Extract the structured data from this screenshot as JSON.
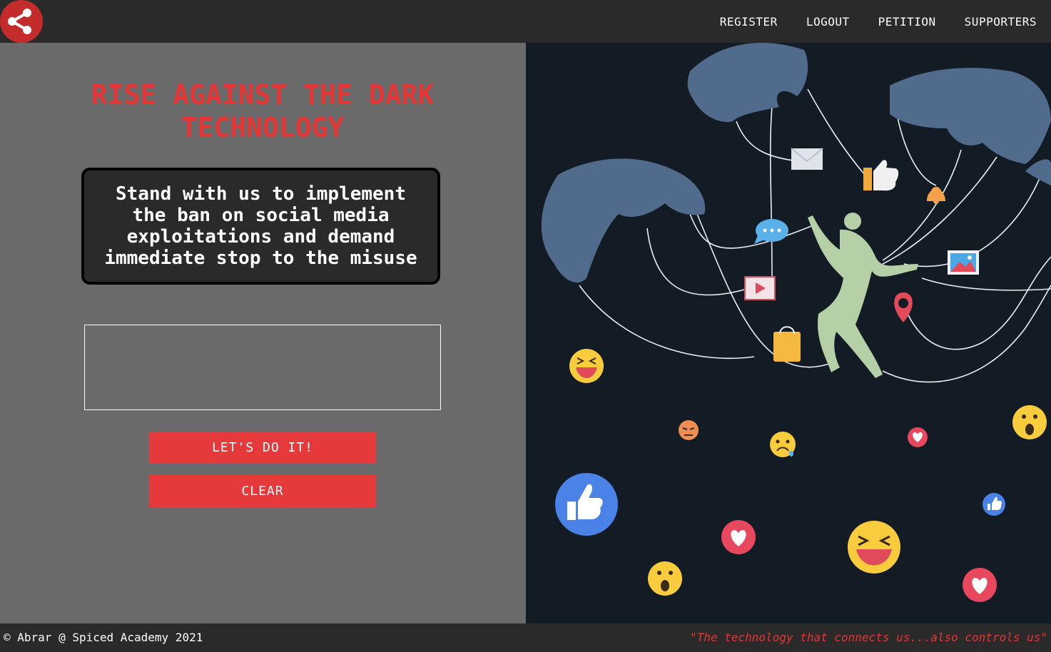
{
  "nav": {
    "logo_icon": "share-icon",
    "links": [
      "REGISTER",
      "LOGOUT",
      "PETITION",
      "SUPPORTERS"
    ]
  },
  "main": {
    "headline": "RISE AGAINST THE DARK TECHNOLOGY",
    "statement": "Stand with us to implement the ban on social media exploitations and demand immediate stop to the misuse",
    "submit_label": "LET'S DO IT!",
    "clear_label": "CLEAR"
  },
  "illustration": {
    "icons": [
      "hand-icon",
      "envelope-icon",
      "thumbs-up-icon",
      "bell-icon",
      "chat-bubble-icon",
      "image-icon",
      "play-icon",
      "location-pin-icon",
      "shopping-bag-icon",
      "laughing-emoji-icon",
      "angry-emoji-icon",
      "sad-emoji-icon",
      "wow-emoji-icon",
      "heart-reaction-icon",
      "like-reaction-icon",
      "puppet-figure"
    ]
  },
  "footer": {
    "copyright": "© Abrar @ Spiced Academy 2021",
    "quote": "\"The technology that connects us...also controls us\""
  },
  "colors": {
    "accent": "#e53535",
    "button": "#e5393b",
    "nav_bg": "#2a2a2a",
    "panel_bg": "#6a6a6a",
    "illustration_bg": "#131c24"
  }
}
